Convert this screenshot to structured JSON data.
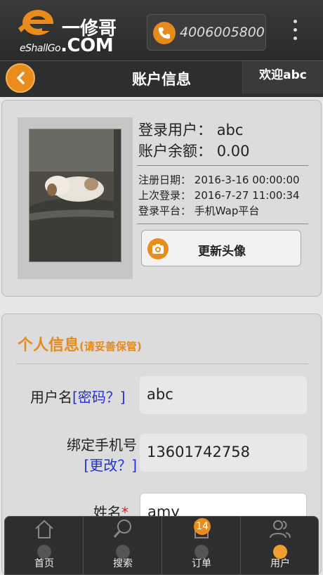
{
  "top_bar": {
    "logo_text_top": "一修哥",
    "logo_text_bottom_small": "eShallGo",
    "logo_text_bottom_large": ".COM",
    "phone_number": "4006005800"
  },
  "header": {
    "title": "账户信息",
    "welcome": "欢迎abc"
  },
  "account": {
    "username_label": "登录用户：",
    "username_value": "abc",
    "balance_label": "账户余额：",
    "balance_value": "0.00",
    "register_label": "注册日期：",
    "register_value": "2016-3-16 00:00:00",
    "last_login_label": "上次登录：",
    "last_login_value": "2016-7-27 11:00:34",
    "platform_label": "登录平台：",
    "platform_value": "手机Wap平台",
    "update_avatar_label": "更新头像"
  },
  "personal": {
    "title": "个人信息",
    "subtitle": "(请妥善保管)",
    "username_label": "用户名",
    "password_link": "[密码？]",
    "username_value": "abc",
    "phone_label": "绑定手机号",
    "change_link": "[更改？]",
    "phone_value": "13601742758",
    "name_label": "姓名",
    "required_mark": "*",
    "name_value": "amy"
  },
  "bottom_nav": {
    "items": [
      {
        "label": "首页",
        "icon": "home-icon"
      },
      {
        "label": "搜索",
        "icon": "search-icon"
      },
      {
        "label": "订单",
        "icon": "order-icon",
        "badge": "14"
      },
      {
        "label": "用户",
        "icon": "user-icon",
        "active": true
      }
    ]
  },
  "colors": {
    "accent": "#e98c1c",
    "link": "#2233cc",
    "dark_bar": "#2e2e2e"
  }
}
